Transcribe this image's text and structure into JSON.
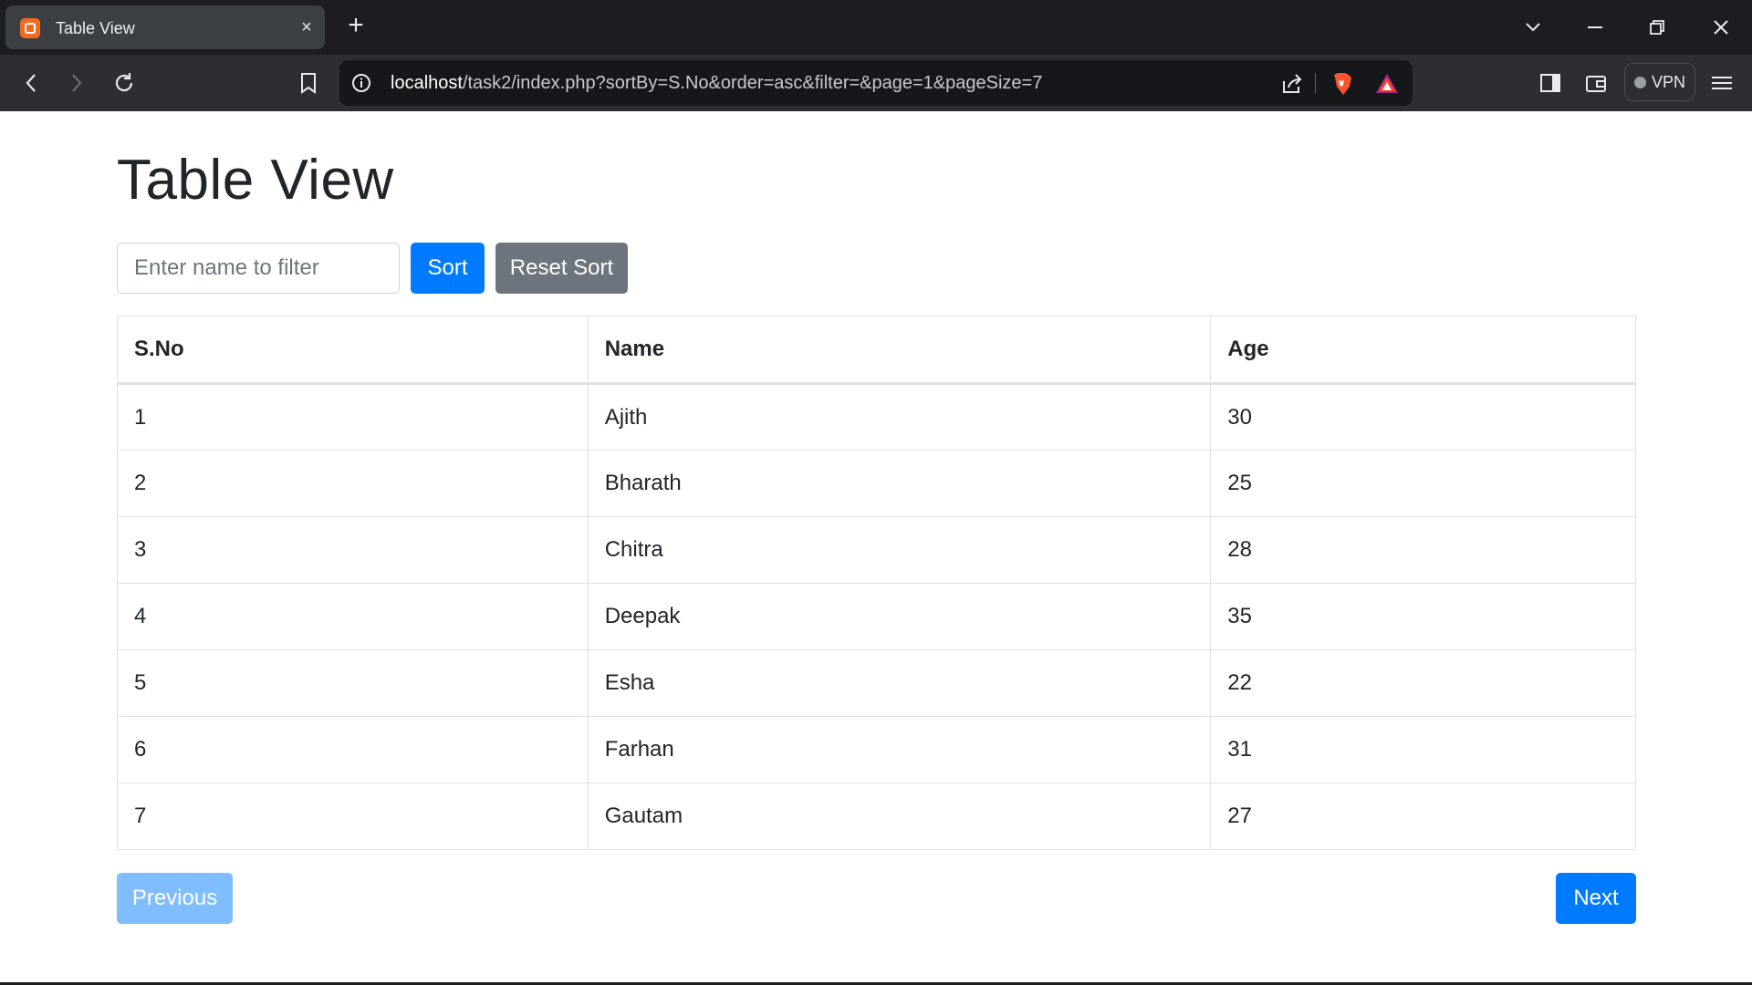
{
  "browser": {
    "tab_title": "Table View",
    "tab_close": "×",
    "new_tab": "+",
    "url_host": "localhost",
    "url_path": "/task2/index.php?sortBy=S.No&order=asc&filter=&page=1&pageSize=7",
    "vpn_label": "VPN",
    "icons": [
      "tab-favicon",
      "close-icon",
      "plus-icon",
      "chevron-down-icon",
      "minimize-icon",
      "restore-icon",
      "close-window-icon",
      "back-icon",
      "forward-icon",
      "reload-icon",
      "bookmark-icon",
      "info-icon",
      "share-icon",
      "brave-shield-icon",
      "brave-rewards-icon",
      "sidebar-icon",
      "wallet-icon",
      "menu-icon"
    ]
  },
  "page": {
    "title": "Table View",
    "filter_placeholder": "Enter name to filter",
    "sort_label": "Sort",
    "reset_sort_label": "Reset Sort",
    "previous_label": "Previous",
    "next_label": "Next"
  },
  "table": {
    "headers": [
      "S.No",
      "Name",
      "Age"
    ],
    "rows": [
      [
        "1",
        "Ajith",
        "30"
      ],
      [
        "2",
        "Bharath",
        "25"
      ],
      [
        "3",
        "Chitra",
        "28"
      ],
      [
        "4",
        "Deepak",
        "35"
      ],
      [
        "5",
        "Esha",
        "22"
      ],
      [
        "6",
        "Farhan",
        "31"
      ],
      [
        "7",
        "Gautam",
        "27"
      ]
    ]
  },
  "colors": {
    "primary": "#007bff",
    "primary_disabled": "#7fbdff",
    "secondary": "#6c757d",
    "chrome_dark": "#1b1d21"
  }
}
